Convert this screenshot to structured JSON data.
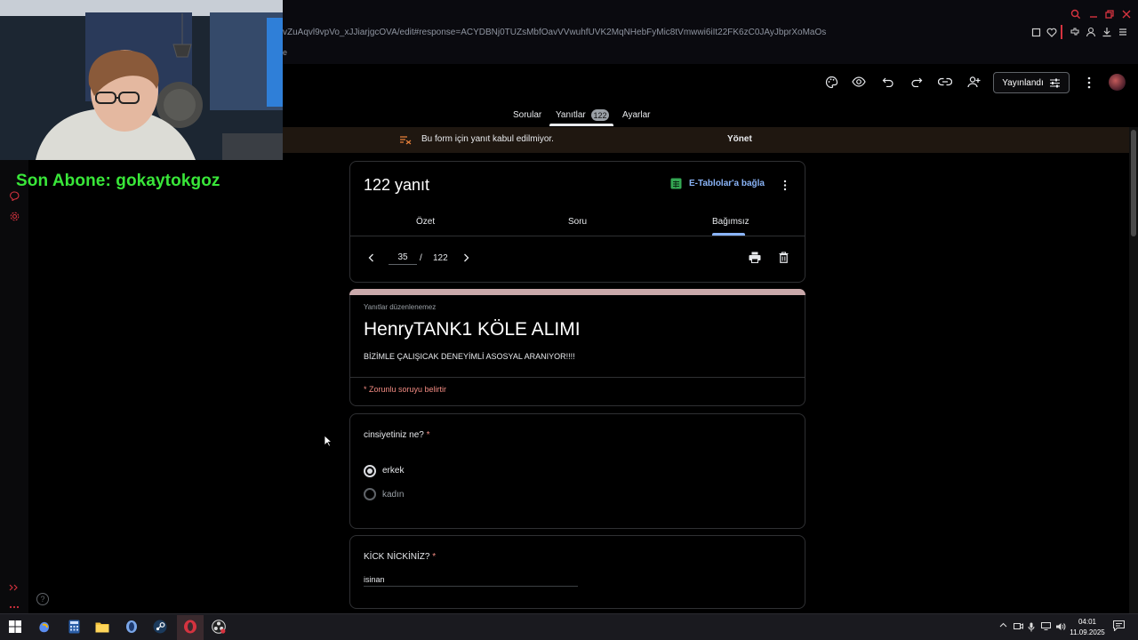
{
  "browser": {
    "url": "vZuAqvl9vpVo_xJJiarjgcOVA/edit#response=ACYDBNj0TUZsMbfOavVVwuhfUVK2MqNHebFyMic8tVmwwi6iIt22FK6zC0JAyJbprXoMaOs",
    "url_fragment": "e"
  },
  "stream": {
    "overlay_text": "Son Abone: gokaytokgoz"
  },
  "forms_header": {
    "publish_label": "Yayınlandı",
    "icons": [
      "palette-icon",
      "eye-icon",
      "undo-icon",
      "redo-icon",
      "link-icon",
      "add-person-icon",
      "more-vert-icon"
    ]
  },
  "tabs": {
    "questions": "Sorular",
    "responses": "Yanıtlar",
    "responses_badge": "122",
    "settings": "Ayarlar"
  },
  "banner": {
    "message": "Bu form için yanıt kabul edilmiyor.",
    "manage_label": "Yönet"
  },
  "summary": {
    "count_label": "122 yanıt",
    "sheets_label": "E-Tablolar'a bağla",
    "subtabs": {
      "summary": "Özet",
      "question": "Soru",
      "individual": "Bağımsız"
    },
    "page_current": "35",
    "page_sep": "/",
    "page_total": "122"
  },
  "form": {
    "readonly_note": "Yanıtlar düzenlenemez",
    "title": "HenryTANK1 KÖLE ALIMI",
    "description": "BİZİMLE ÇALIŞICAK DENEYİMLİ ASOSYAL ARANIYOR!!!!",
    "required_note": "* Zorunlu soruyu belirtir"
  },
  "questions": [
    {
      "label": "cinsiyetiniz ne?",
      "required_mark": "*",
      "options": [
        "erkek",
        "kadın"
      ],
      "selected": "erkek"
    },
    {
      "label": "KİCK NİCKİNİZ?",
      "required_mark": "*",
      "answer": "isinan"
    }
  ],
  "taskbar": {
    "time": "04:01",
    "date": "11.09.2025",
    "apps": [
      "windows-start-icon",
      "copilot-icon",
      "calculator-icon",
      "file-explorer-icon",
      "app-icon",
      "steam-icon",
      "opera-icon",
      "obs-icon"
    ]
  },
  "colors": {
    "accent_blue": "#8ab4f8",
    "required_red": "#f28b82",
    "overlay_green": "#39e639",
    "title_band": "#c9a8aa"
  }
}
